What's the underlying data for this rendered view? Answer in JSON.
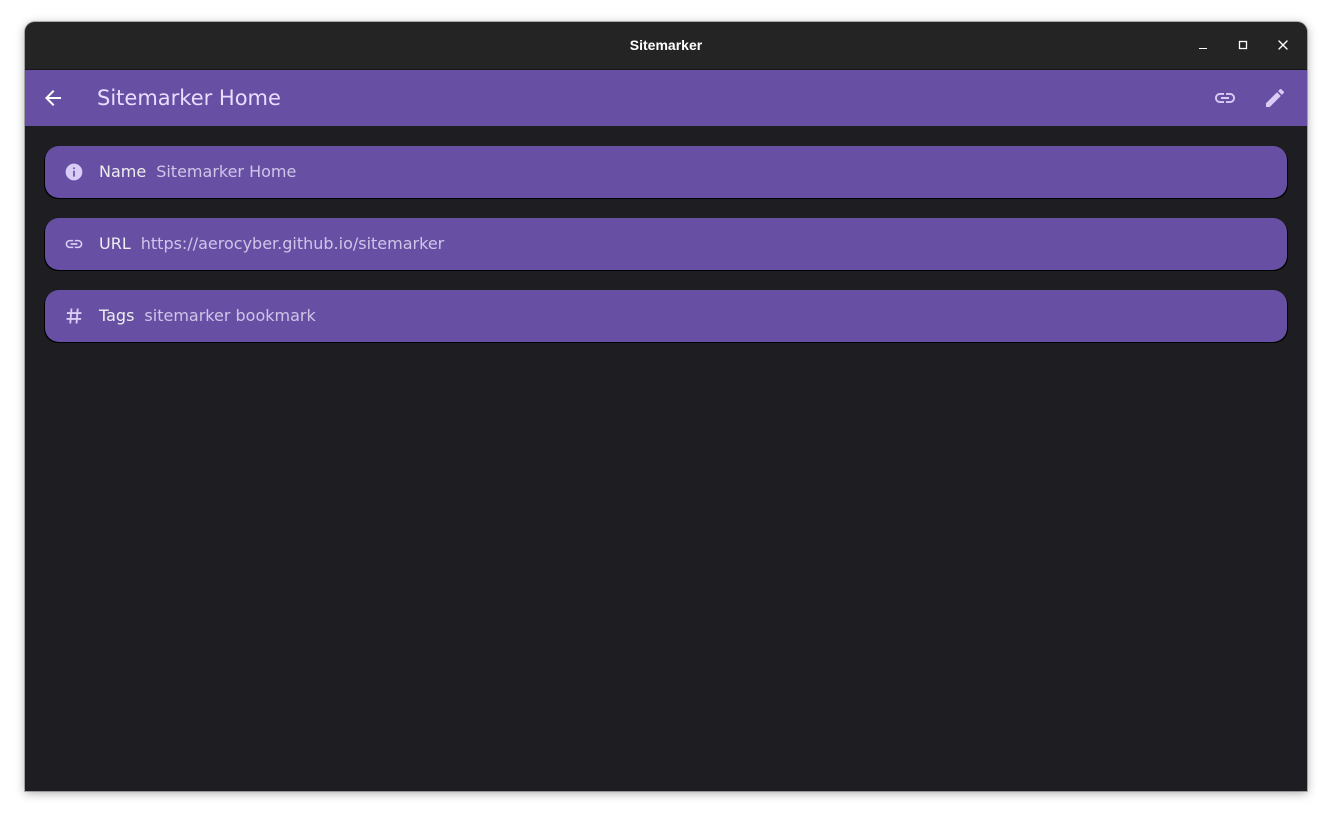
{
  "window": {
    "title": "Sitemarker",
    "controls": {
      "minimize_icon": "minimize-icon",
      "maximize_icon": "maximize-icon",
      "close_icon": "close-icon"
    }
  },
  "appbar": {
    "title": "Sitemarker Home",
    "back_icon": "arrow-left-icon",
    "actions": [
      {
        "icon": "link-icon"
      },
      {
        "icon": "pencil-icon"
      }
    ]
  },
  "fields": [
    {
      "label": "Name",
      "value": "Sitemarker Home",
      "icon": "info-icon"
    },
    {
      "label": "URL",
      "value": "https://aerocyber.github.io/sitemarker",
      "icon": "link-icon"
    },
    {
      "label": "Tags",
      "value": "sitemarker bookmark",
      "icon": "hash-icon"
    }
  ],
  "colors": {
    "accent": "#6750a4",
    "background": "#1e1d21",
    "titlebar": "#242424",
    "title_text": "#e8ddff",
    "label_text": "#eeeeee",
    "value_text": "#cfc5e8"
  }
}
